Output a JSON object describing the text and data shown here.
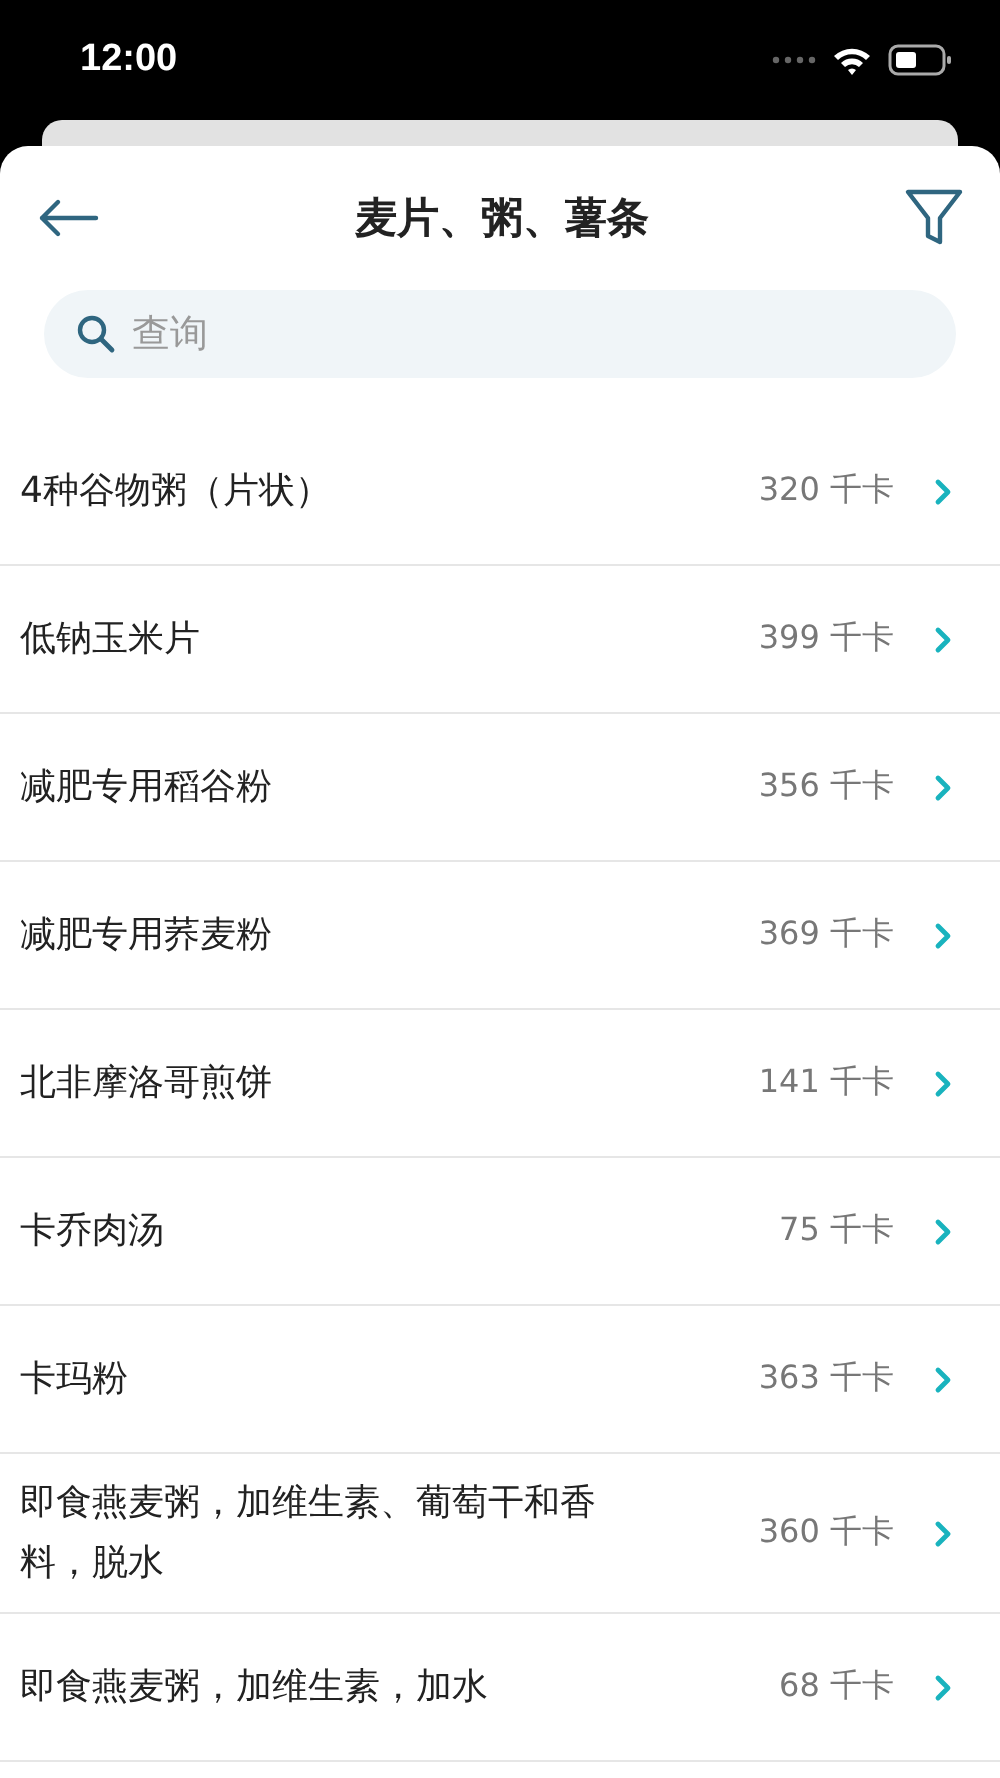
{
  "status_bar": {
    "time": "12:00"
  },
  "header": {
    "title": "麦片、粥、薯条"
  },
  "search": {
    "placeholder": "查询"
  },
  "items": [
    {
      "name": "4种谷物粥（片状）",
      "calories": "320 千卡"
    },
    {
      "name": "低钠玉米片",
      "calories": "399 千卡"
    },
    {
      "name": "减肥专用稻谷粉",
      "calories": "356 千卡"
    },
    {
      "name": "减肥专用荞麦粉",
      "calories": "369 千卡"
    },
    {
      "name": "北非摩洛哥煎饼",
      "calories": "141 千卡"
    },
    {
      "name": "卡乔肉汤",
      "calories": "75 千卡"
    },
    {
      "name": "卡玛粉",
      "calories": "363 千卡"
    },
    {
      "name": "即食燕麦粥，加维生素、葡萄干和香料，脱水",
      "calories": "360 千卡"
    },
    {
      "name": "即食燕麦粥，加维生素，加水",
      "calories": "68 千卡"
    }
  ]
}
